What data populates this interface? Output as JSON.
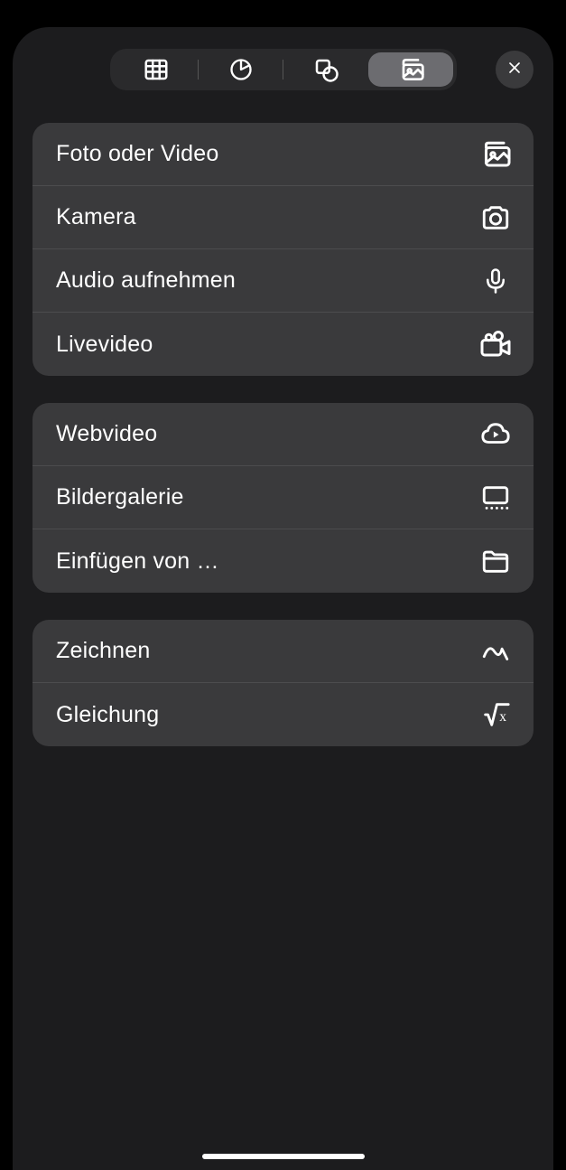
{
  "tabs": [
    {
      "name": "table"
    },
    {
      "name": "chart"
    },
    {
      "name": "shape"
    },
    {
      "name": "media",
      "active": true
    }
  ],
  "groups": [
    {
      "rows": [
        {
          "label": "Foto oder Video",
          "icon": "photo"
        },
        {
          "label": "Kamera",
          "icon": "camera"
        },
        {
          "label": "Audio aufnehmen",
          "icon": "microphone"
        },
        {
          "label": "Livevideo",
          "icon": "videocamera"
        }
      ]
    },
    {
      "rows": [
        {
          "label": "Webvideo",
          "icon": "cloud-play"
        },
        {
          "label": "Bildergalerie",
          "icon": "gallery"
        },
        {
          "label": "Einfügen von …",
          "icon": "folder"
        }
      ]
    },
    {
      "rows": [
        {
          "label": "Zeichnen",
          "icon": "scribble"
        },
        {
          "label": "Gleichung",
          "icon": "equation"
        }
      ]
    }
  ]
}
